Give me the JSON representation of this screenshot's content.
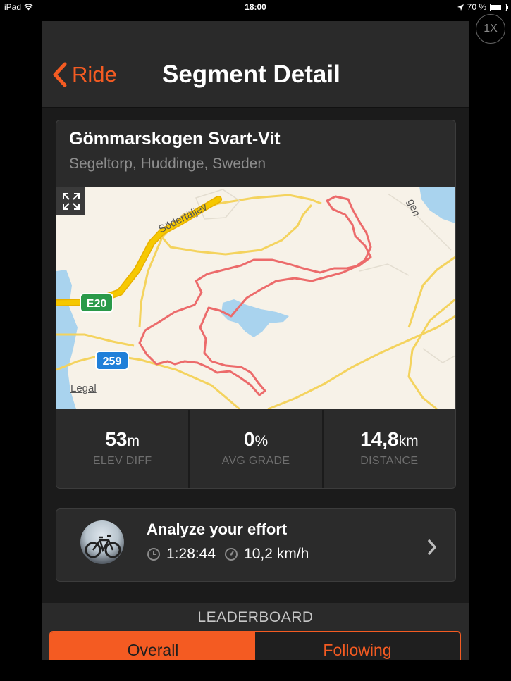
{
  "status_bar": {
    "device": "iPad",
    "time": "18:00",
    "battery": "70 %"
  },
  "zoom_button": "1X",
  "navbar": {
    "back_label": "Ride",
    "title": "Segment Detail"
  },
  "segment": {
    "name": "Gömmarskogen Svart-Vit",
    "location": "Segeltorp, Huddinge, Sweden"
  },
  "map": {
    "road_labels": {
      "sodertalje": "Södertäljev",
      "gen": "gen",
      "e20": "E20",
      "r259": "259"
    },
    "legal": "Legal",
    "route_color": "#ec6b6b",
    "water_color": "#a9d3ee",
    "road_color": "#f4d35e",
    "highway_color": "#f2c400"
  },
  "stats": [
    {
      "value": "53",
      "unit": "m",
      "label": "ELEV DIFF"
    },
    {
      "value": "0",
      "unit": "%",
      "label": "AVG GRADE"
    },
    {
      "value": "14,8",
      "unit": "km",
      "label": "DISTANCE"
    }
  ],
  "analyze": {
    "title": "Analyze your effort",
    "time": "1:28:44",
    "speed": "10,2 km/h"
  },
  "leaderboard": {
    "title": "LEADERBOARD",
    "tabs": [
      {
        "label": "Overall",
        "active": true
      },
      {
        "label": "Following",
        "active": false
      }
    ]
  },
  "colors": {
    "accent": "#f45b22",
    "background": "#1b1b1b",
    "card": "#2b2b2b"
  }
}
